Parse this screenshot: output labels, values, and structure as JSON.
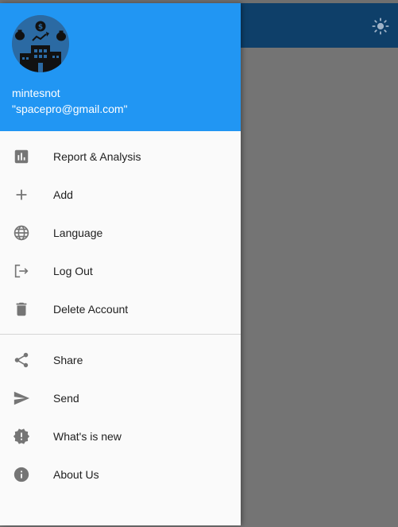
{
  "colors": {
    "header_bg": "#2196f3",
    "app_bar_bg": "#0e3f69",
    "scrim": "#747474",
    "icon_grey": "#757575"
  },
  "app_bar": {
    "theme_icon": "sun-icon"
  },
  "drawer": {
    "user": {
      "name": "mintesnot",
      "email": "\"spacepro@gmail.com\""
    },
    "primary_items": [
      {
        "label": "Report & Analysis",
        "icon": "bar-chart-icon"
      },
      {
        "label": "Add",
        "icon": "plus-icon"
      },
      {
        "label": "Language",
        "icon": "globe-icon"
      },
      {
        "label": "Log Out",
        "icon": "logout-icon"
      },
      {
        "label": "Delete Account",
        "icon": "trash-icon"
      }
    ],
    "secondary_items": [
      {
        "label": "Share",
        "icon": "share-icon"
      },
      {
        "label": "Send",
        "icon": "send-icon"
      },
      {
        "label": "What's is new",
        "icon": "new-releases-icon"
      },
      {
        "label": "About Us",
        "icon": "info-icon"
      }
    ]
  }
}
